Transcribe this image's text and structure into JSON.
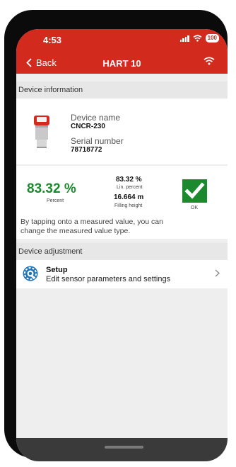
{
  "status": {
    "time": "4:53",
    "battery": "100"
  },
  "nav": {
    "back_label": "Back",
    "title": "HART 10"
  },
  "device_info": {
    "section_label": "Device information",
    "name_label": "Device name",
    "name_value": "CNCR-230",
    "serial_label": "Serial number",
    "serial_value": "78718772"
  },
  "measurement": {
    "main_value": "83.32 %",
    "main_label": "Percent",
    "lin_value": "83.32 %",
    "lin_label": "Lin. percent",
    "height_value": "16.664 m",
    "height_label": "Filling height",
    "status_label": "OK",
    "hint": "By tapping onto a measured value, you can change the measured value type."
  },
  "adjustment": {
    "section_label": "Device adjustment",
    "setup_title": "Setup",
    "setup_subtitle": "Edit sensor parameters  and settings"
  },
  "colors": {
    "brand_red": "#d32a1e",
    "status_green": "#1b8a2e",
    "setup_blue": "#1f73b7"
  },
  "icons": [
    "back-chevron-icon",
    "wifi-icon",
    "signal-icon",
    "battery-icon",
    "checkmark-icon",
    "gear-wrench-icon",
    "chevron-right-icon",
    "device-sensor-image"
  ]
}
